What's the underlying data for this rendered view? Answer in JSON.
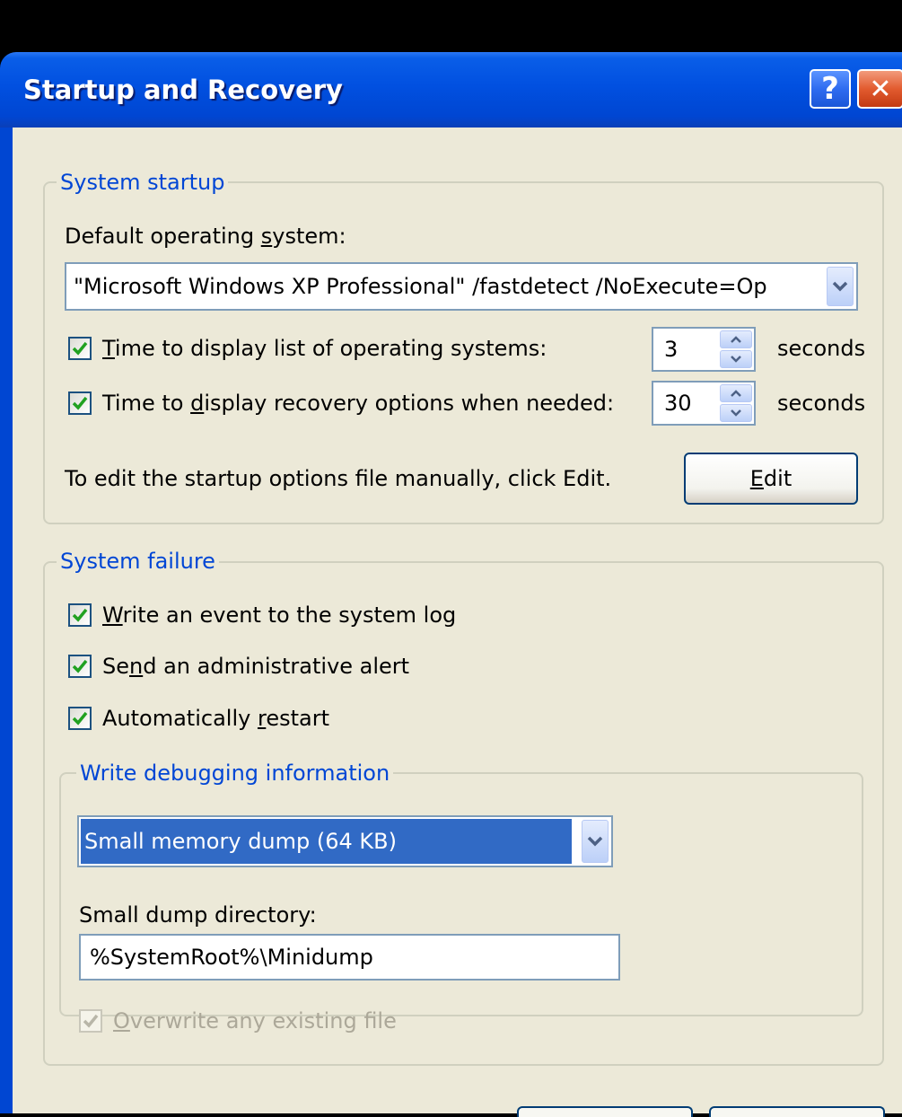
{
  "window": {
    "title": "Startup and Recovery",
    "help_glyph": "?",
    "close_glyph": "✕"
  },
  "system_startup": {
    "legend": "System startup",
    "default_os_label": {
      "pre": "Default operating ",
      "key": "s",
      "post": "ystem:"
    },
    "default_os_value": "\"Microsoft Windows XP Professional\" /fastdetect /NoExecute=Op",
    "display_list": {
      "checked": true,
      "label": {
        "pre": "",
        "key": "T",
        "post": "ime to display list of operating systems:"
      },
      "value": "3",
      "unit": "seconds"
    },
    "display_recovery": {
      "checked": true,
      "label": {
        "pre": "Time to ",
        "key": "d",
        "post": "isplay recovery options when needed:"
      },
      "value": "30",
      "unit": "seconds"
    },
    "edit_hint": "To edit the startup options file manually, click Edit.",
    "edit_button": {
      "pre": "",
      "key": "E",
      "post": "dit"
    }
  },
  "system_failure": {
    "legend": "System failure",
    "write_event": {
      "checked": true,
      "label": {
        "pre": "",
        "key": "W",
        "post": "rite an event to the system log"
      }
    },
    "send_alert": {
      "checked": true,
      "label": {
        "pre": "Se",
        "key": "n",
        "post": "d an administrative alert"
      }
    },
    "auto_restart": {
      "checked": true,
      "label": {
        "pre": "Automatically ",
        "key": "r",
        "post": "estart"
      }
    },
    "debug": {
      "legend": "Write debugging information",
      "dump_type": "Small memory dump (64 KB)",
      "dir_label": "Small dump directory:",
      "dir_value": "%SystemRoot%\\Minidump",
      "overwrite": {
        "checked": true,
        "disabled": true,
        "label": {
          "pre": "",
          "key": "O",
          "post": "verwrite any existing file"
        }
      }
    }
  },
  "colors": {
    "title_bar": "#0150e0",
    "dialog_bg": "#ece9d8",
    "group_legend": "#0046d5",
    "selection": "#316ac5",
    "check": "#21a121"
  },
  "icons": [
    "help-icon",
    "close-icon",
    "chevron-down-icon",
    "spin-up-icon",
    "spin-down-icon",
    "checkmark-icon"
  ]
}
